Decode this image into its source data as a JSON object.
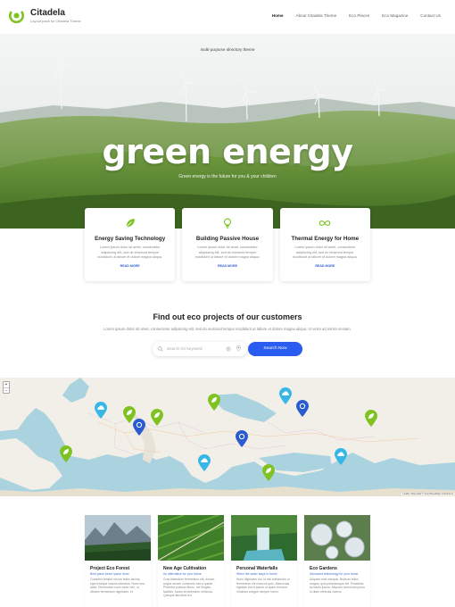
{
  "site": {
    "title": "Citadela",
    "tagline": "Layout pack for Citadela Theme"
  },
  "nav": {
    "items": [
      {
        "label": "Home",
        "active": true
      },
      {
        "label": "About Citadela Theme",
        "active": false
      },
      {
        "label": "Eco Places",
        "active": false
      },
      {
        "label": "Eco Magazine",
        "active": false
      },
      {
        "label": "Contact Us",
        "active": false
      }
    ]
  },
  "hero": {
    "kicker": "multi-purpose directory theme",
    "title": "green energy",
    "subtitle": "Green energy is the future for you & your children"
  },
  "features": [
    {
      "icon": "leaf-icon",
      "title": "Energy Saving Technology",
      "text": "Lorem ipsum dolor sit amet, consectetur adipiscing elit, sed do eiusmod tempor incididunt ut labore et dolore magna aliqua.",
      "link": "READ MORE"
    },
    {
      "icon": "lightbulb-icon",
      "title": "Building Passive House",
      "text": "Lorem ipsum dolor sit amet, consectetur adipiscing elit, sed do eiusmod tempor incididunt ut labore et dolore magna aliqua.",
      "link": "READ MORE"
    },
    {
      "icon": "infinity-icon",
      "title": "Thermal Energy for Home",
      "text": "Lorem ipsum dolor sit amet, consectetur adipiscing elit, sed do eiusmod tempor incididunt ut labore et dolore magna aliqua.",
      "link": "READ MORE"
    }
  ],
  "find": {
    "title": "Find out eco projects of our customers",
    "text": "Lorem ipsum dolor sit amet, consectetur adipiscing elit, sed do eiusmod tempor incididunt ut labore et dolore magna aliqua. Ut enim ad minim veniam.",
    "search_placeholder": "Search for keyword",
    "search_button": "Search Now"
  },
  "map": {
    "zoom_in": "+",
    "zoom_out": "−",
    "attribution": "Leaflet | Map data © OpenStreetMap contributors"
  },
  "projects": [
    {
      "title": "Project Eco Forest",
      "tag": "Best place lorem ipsum dolor",
      "text": "Curabitur tempor nisi ac tellus lacinia, eget tristique mauris interdum. Nunc sed dolor. Elementum nunc tortor nec, ut ultrices fermentum dignissim, et."
    },
    {
      "title": "New Age Cultivation",
      "tag": "An alternative for your future",
      "text": "Cras bibendum fermentum elit, dictum augue ornare commodo sed a ipsum. Pharetra pulvinar libero, vel fringilla facilisis, luctus at bibendum vehicula. Quisque faucibus leo."
    },
    {
      "title": "Personal Waterfalls",
      "tag": "When the water stays in forest",
      "text": "Nunc dignissim dui, id nisi sollicitudin, in fermentum elit rhoncus quis. Maecenas egestas dui id ipsum ut quam rhoncus. Vivamus congue semper lorem."
    },
    {
      "title": "Eco Gardens",
      "tag": "Advanced technology for your home",
      "text": "Aliquam erat volutpat. Nulla ac tellus magna, quis pellentesque elit. Phasellus ac turpis ipsum. Aliquam commodo purus in diam vehicula viverra."
    }
  ],
  "colors": {
    "accent_green": "#7ec322",
    "marker_blue": "#2a5cd0",
    "marker_cyan": "#36b7e6",
    "button_blue": "#2a5cf0"
  }
}
